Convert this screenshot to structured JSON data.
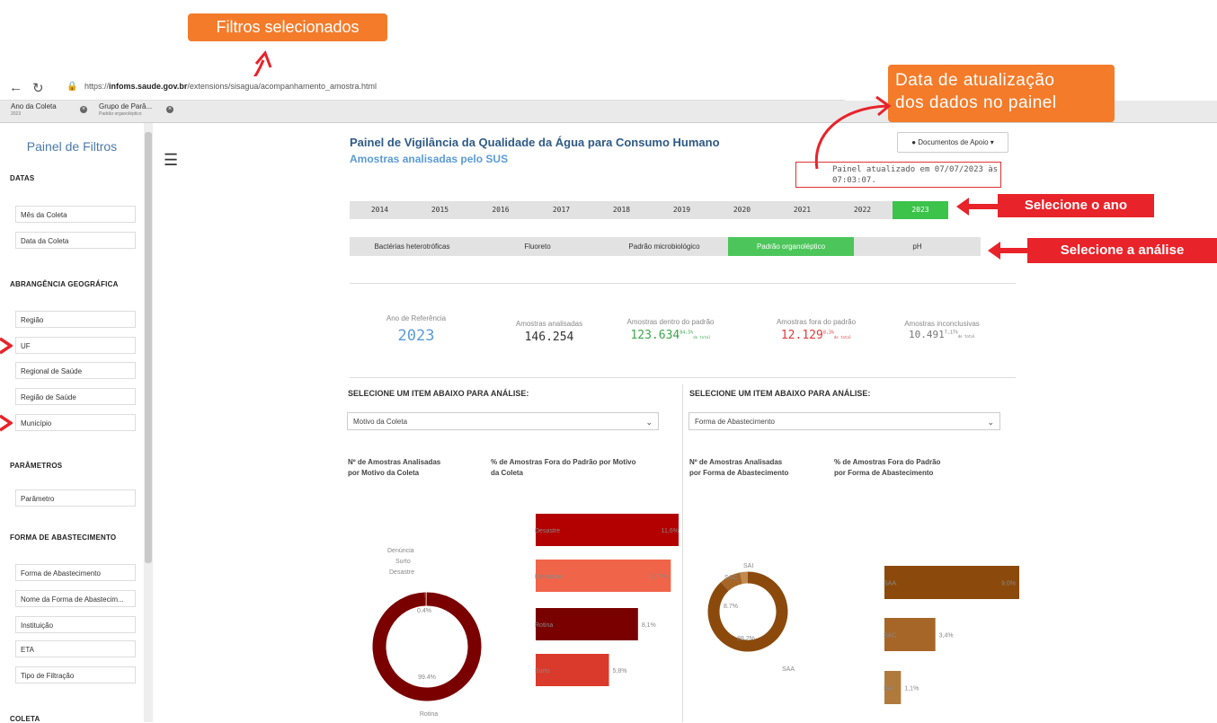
{
  "annotations": {
    "filters": "Filtros selecionados",
    "update_line1": "Data de atualização",
    "update_line2": "dos dados no painel",
    "select_year": "Selecione o ano",
    "select_analysis": "Selecione a análise"
  },
  "browser": {
    "url_prefix": "https://",
    "url_host": "infoms.saude.gov.br",
    "url_path": "/extensions/sisagua/acompanhamento_amostra.html"
  },
  "filter_chips": [
    {
      "label": "Ano da Coleta",
      "value": "2023"
    },
    {
      "label": "Grupo de Parâ...",
      "value": "Padrão organoléptico"
    }
  ],
  "sidebar": {
    "title": "Painel de Filtros",
    "sections": {
      "datas": "DATAS",
      "abrangencia": "ABRANGÊNCIA GEOGRÁFICA",
      "parametros": "PARÂMETROS",
      "forma": "FORMA DE ABASTECIMENTO",
      "coleta": "COLETA"
    },
    "fields": {
      "mes": "Mês da Coleta",
      "data": "Data da Coleta",
      "regiao": "Região",
      "uf": "UF",
      "regional": "Regional de Saúde",
      "regiao_saude": "Região de Saúde",
      "municipio": "Município",
      "parametro": "Parâmetro",
      "forma_abast": "Forma de Abastecimento",
      "nome_forma": "Nome da Forma de Abastecim...",
      "instituicao": "Instituição",
      "eta": "ETA",
      "filtracao": "Tipo de Filtração"
    }
  },
  "header": {
    "title": "Painel de Vigilância da Qualidade da Água para Consumo Humano",
    "subtitle": "Amostras analisadas pelo SUS",
    "docs_button": "Documentos de Apoio ▾",
    "updated_line1": "Painel atualizado em 07/07/2023 às",
    "updated_line2": "07:03:07."
  },
  "years": [
    "2014",
    "2015",
    "2016",
    "2017",
    "2018",
    "2019",
    "2020",
    "2021",
    "2022",
    "2023"
  ],
  "selected_year": "2023",
  "analyses": [
    "Bactérias heterotróficas",
    "Fluoreto",
    "Padrão microbiológico",
    "Padrão organoléptico",
    "pH"
  ],
  "selected_analysis": "Padrão organoléptico",
  "kpis": {
    "ref_label": "Ano de Referência",
    "ref_value": "2023",
    "analisadas_label": "Amostras analisadas",
    "analisadas_value": "146.254",
    "dentro_label": "Amostras dentro do padrão",
    "dentro_value": "123.634",
    "dentro_pct": "84,5%",
    "dentro_sub": "do total",
    "fora_label": "Amostras fora do padrão",
    "fora_value": "12.129",
    "fora_pct": "8,3%",
    "fora_sub": "do total",
    "inconc_label": "Amostras inconclusivas",
    "inconc_value": "10.491",
    "inconc_pct": "7,17%",
    "inconc_sub": "do total"
  },
  "left_panel": {
    "select_head": "SELECIONE UM ITEM ABAIXO PARA ANÁLISE:",
    "dropdown": "Motivo da Coleta",
    "chart1_title_1": "Nº de Amostras Analisadas",
    "chart1_title_2": "por Motivo da Coleta",
    "chart2_title_1": "% de Amostras Fora do Padrão por Motivo",
    "chart2_title_2": "da Coleta"
  },
  "right_panel": {
    "select_head": "SELECIONE UM ITEM ABAIXO PARA ANÁLISE:",
    "dropdown": "Forma de Abastecimento",
    "chart1_title_1": "Nº de Amostras Analisadas",
    "chart1_title_2": "por Forma de Abastecimento",
    "chart2_title_1": "% de Amostras Fora do Padrão",
    "chart2_title_2": "por Forma de Abastecimento"
  },
  "chart_data": [
    {
      "type": "pie",
      "labels": [
        "Rotina",
        "Denúncia",
        "Surto",
        "Desastre"
      ],
      "values": [
        99.4,
        0.4,
        0.1,
        0.1
      ],
      "value_labels": [
        "99.4%",
        "0.4%"
      ],
      "colors": [
        "#7a0000",
        "#c0392b",
        "#e05a4a",
        "#999999"
      ]
    },
    {
      "type": "bar",
      "orientation": "horizontal",
      "categories": [
        "Desastre",
        "Denúncia",
        "Rotina",
        "Surto"
      ],
      "values": [
        11.6,
        10.7,
        8.1,
        5.8
      ],
      "value_labels": [
        "11,6%",
        "10,7%",
        "8,1%",
        "5,8%"
      ],
      "colors": [
        "#b30000",
        "#f0654a",
        "#7a0000",
        "#d93a2b"
      ],
      "xlim": [
        0,
        11.6
      ]
    },
    {
      "type": "pie",
      "labels": [
        "SAA",
        "SAC",
        "SAI"
      ],
      "values": [
        88.2,
        8.7,
        3.1
      ],
      "value_labels": [
        "88.2%",
        "8.7%"
      ],
      "colors": [
        "#8b4a0c",
        "#a56628",
        "#c08a50"
      ]
    },
    {
      "type": "bar",
      "orientation": "horizontal",
      "categories": [
        "SAA",
        "SAC",
        "SAI"
      ],
      "values": [
        9.0,
        3.4,
        1.1
      ],
      "value_labels": [
        "9,0%",
        "3,4%",
        "1,1%"
      ],
      "colors": [
        "#8b4a0c",
        "#a56628",
        "#b07a3c"
      ],
      "xlim": [
        0,
        9.0
      ]
    }
  ]
}
